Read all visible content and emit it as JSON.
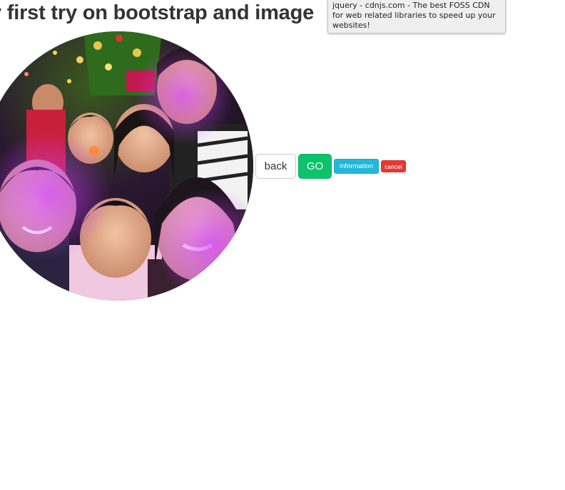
{
  "page": {
    "heading": "y first try on bootstrap and image"
  },
  "tooltip": {
    "text": "jquery - cdnjs.com - The best FOSS CDN for web related libraries to speed up your websites!"
  },
  "photo": {
    "alt_description": "circular family selfie photo"
  },
  "buttons": {
    "back_label": "back",
    "go_label": "GO",
    "info_label": "information",
    "cancel_label": "cancel"
  },
  "colors": {
    "go": "#0cc26b",
    "info": "#22b8d9",
    "cancel": "#e53935"
  }
}
